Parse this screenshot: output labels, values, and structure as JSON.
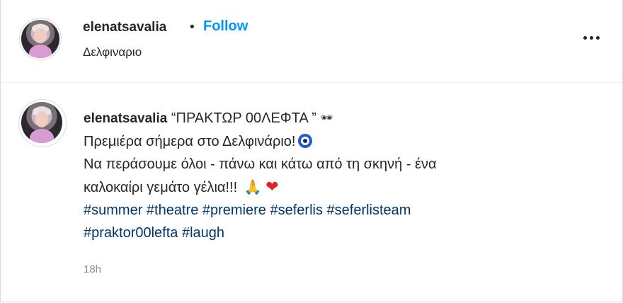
{
  "header": {
    "username": "elenatsavalia",
    "separator": "•",
    "follow_label": "Follow",
    "location": "Δελφιναριο",
    "more_icon": "more-horizontal-icon"
  },
  "caption": {
    "username": "elenatsavalia",
    "line1_text": "“ΠΡΑΚΤΩΡ 00ΛΕΦΤΑ ”",
    "line1_emoji": "🕶",
    "line2_text": "Πρεμιέρα σήμερα στο Δελφινάριο!",
    "line3_text": "Να περάσουμε όλοι - πάνω και κάτω από τη σκηνή - ένα",
    "line4_text": "καλοκαίρι γεμάτο γέλια!!!",
    "pray_emoji": "🙏",
    "heart_emoji": "❤",
    "hashtags_line1": [
      "#summer",
      "#theatre",
      "#premiere",
      "#seferlis",
      "#seferlisteam"
    ],
    "hashtags_line2": [
      "#praktor00lefta",
      "#laugh"
    ]
  },
  "timestamp": "18h",
  "colors": {
    "follow": "#0095f6",
    "hashtag": "#00376b",
    "text": "#262626",
    "muted": "#8e8e8e",
    "heart": "#e02424"
  }
}
